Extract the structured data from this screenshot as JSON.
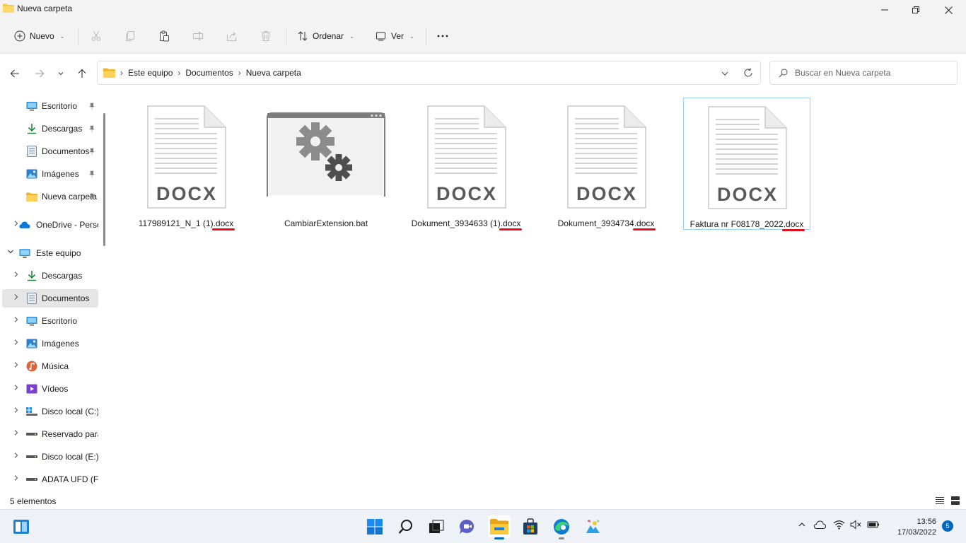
{
  "window": {
    "title": "Nueva carpeta",
    "minimize_icon": "minimize-icon",
    "maximize_icon": "restore-icon",
    "close_icon": "close-icon"
  },
  "commandbar": {
    "new_label": "Nuevo",
    "sort_label": "Ordenar",
    "view_label": "Ver",
    "disabled_actions": [
      "cut-icon",
      "copy-icon",
      "paste-icon",
      "rename-icon",
      "share-icon",
      "delete-icon"
    ],
    "more_icon": "more-icon"
  },
  "address": {
    "crumbs": [
      "Este equipo",
      "Documentos",
      "Nueva carpeta"
    ]
  },
  "search": {
    "placeholder": "Buscar en Nueva carpeta"
  },
  "sidebar": {
    "quick_access": [
      {
        "label": "Escritorio",
        "icon": "desktop-icon",
        "pinned": true
      },
      {
        "label": "Descargas",
        "icon": "download-icon",
        "pinned": true
      },
      {
        "label": "Documentos",
        "icon": "documents-icon",
        "pinned": true
      },
      {
        "label": "Imágenes",
        "icon": "pictures-icon",
        "pinned": true
      },
      {
        "label": "Nueva carpeta",
        "icon": "folder-icon",
        "pinned": true
      }
    ],
    "onedrive": {
      "label": "OneDrive - Personal",
      "icon": "cloud-icon"
    },
    "this_pc": {
      "label": "Este equipo",
      "icon": "computer-icon"
    },
    "this_pc_items": [
      {
        "label": "Descargas",
        "icon": "download-icon"
      },
      {
        "label": "Documentos",
        "icon": "documents-icon",
        "selected": true
      },
      {
        "label": "Escritorio",
        "icon": "desktop-icon"
      },
      {
        "label": "Imágenes",
        "icon": "pictures-icon"
      },
      {
        "label": "Música",
        "icon": "music-icon"
      },
      {
        "label": "Vídeos",
        "icon": "videos-icon"
      },
      {
        "label": "Disco local (C:)",
        "icon": "drive-c-icon"
      },
      {
        "label": "Reservado para el sistema",
        "icon": "drive-icon"
      },
      {
        "label": "Disco local (E:)",
        "icon": "drive-icon"
      },
      {
        "label": "ADATA UFD (F:)",
        "icon": "usb-drive-icon"
      }
    ]
  },
  "files": [
    {
      "name": "117989121_N_1 (1).docx",
      "type_label": "DOCX",
      "kind": "docx",
      "ext_underlined": true
    },
    {
      "name": "CambiarExtension.bat",
      "type_label": "",
      "kind": "bat",
      "ext_underlined": false
    },
    {
      "name": "Dokument_3934633 (1).docx",
      "type_label": "DOCX",
      "kind": "docx",
      "ext_underlined": true
    },
    {
      "name": "Dokument_3934734.docx",
      "type_label": "DOCX",
      "kind": "docx",
      "ext_underlined": true
    },
    {
      "name": "Faktura nr F08178_2022.docx",
      "type_label": "DOCX",
      "kind": "docx",
      "ext_underlined": true,
      "selected": true
    }
  ],
  "statusbar": {
    "count": "5 elementos"
  },
  "taskbar": {
    "apps": [
      "windows-start-icon",
      "search-icon",
      "task-view-icon",
      "chat-icon",
      "file-explorer-icon",
      "store-icon",
      "edge-icon",
      "photos-icon"
    ],
    "active_app": "file-explorer-icon",
    "time": "13:56",
    "date": "17/03/2022",
    "notifications": "5"
  },
  "colors": {
    "accent": "#0067c0",
    "underline": "#e0101e",
    "folder": "#f7c948"
  }
}
